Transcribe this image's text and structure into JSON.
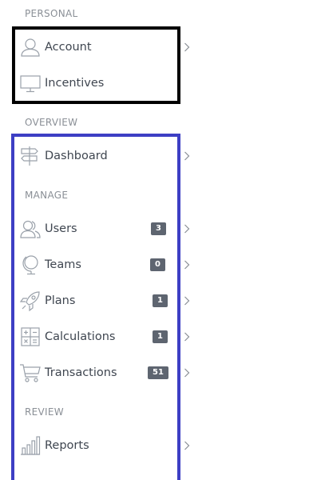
{
  "sections": {
    "personal": "PERSONAL",
    "overview": "OVERVIEW",
    "manage": "MANAGE",
    "review": "REVIEW"
  },
  "nav": {
    "account": {
      "label": "Account",
      "icon": "user-icon"
    },
    "incentives": {
      "label": "Incentives",
      "icon": "monitor-icon"
    },
    "dashboard": {
      "label": "Dashboard",
      "icon": "signpost-icon"
    },
    "users": {
      "label": "Users",
      "icon": "users-icon",
      "badge": "3"
    },
    "teams": {
      "label": "Teams",
      "icon": "globe-icon",
      "badge": "0"
    },
    "plans": {
      "label": "Plans",
      "icon": "rocket-icon",
      "badge": "1"
    },
    "calculations": {
      "label": "Calculations",
      "icon": "calculator-icon",
      "badge": "1"
    },
    "transactions": {
      "label": "Transactions",
      "icon": "cart-icon",
      "badge": "51"
    },
    "reports": {
      "label": "Reports",
      "icon": "bar-chart-icon"
    }
  },
  "colors": {
    "highlight_personal": "#000000",
    "highlight_main": "#3d3fc4",
    "badge_bg": "#5e6570",
    "label_text": "#3f4650",
    "section_text": "#8a8f96",
    "icon_stroke": "#9aa1aa"
  }
}
